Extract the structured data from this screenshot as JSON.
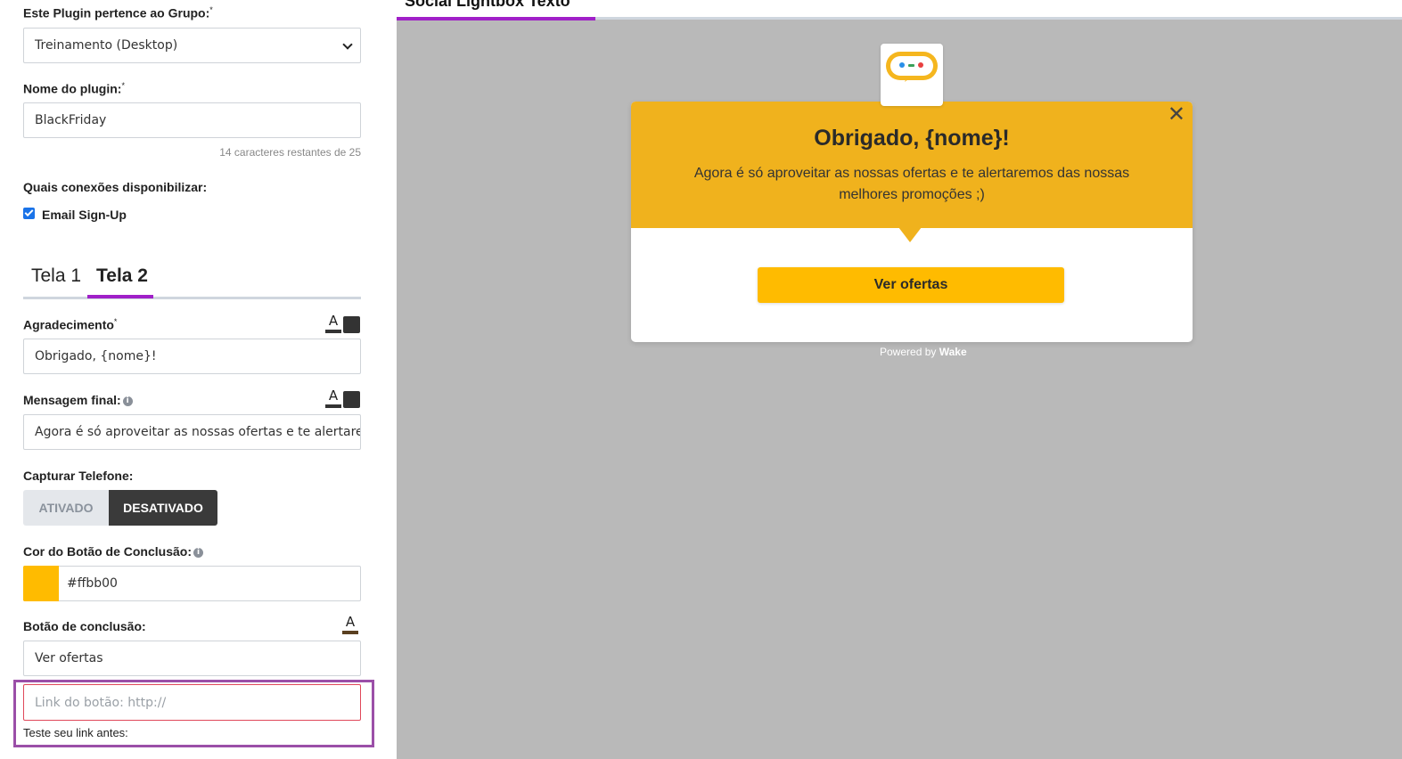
{
  "form": {
    "group_label": "Este Plugin pertence ao Grupo:",
    "group_value": "Treinamento (Desktop)",
    "name_label": "Nome do plugin:",
    "name_value": "BlackFriday",
    "name_counter": "14 caracteres restantes de 25",
    "connections_label": "Quais conexões disponibilizar:",
    "connection_email": "Email Sign-Up",
    "tabs": [
      {
        "label": "Tela 1",
        "active": false
      },
      {
        "label": "Tela 2",
        "active": true
      }
    ],
    "thanks_label": "Agradecimento",
    "thanks_value": "Obrigado, {nome}!",
    "final_msg_label": "Mensagem final:",
    "final_msg_value": "Agora é só aproveitar as nossas ofertas e te alertaremos das nossas melhores promoções ;)",
    "phone_label": "Capturar Telefone:",
    "phone_on": "ATIVADO",
    "phone_off": "DESATIVADO",
    "btn_color_label": "Cor do Botão de Conclusão:",
    "btn_color_value": "#ffbb00",
    "btn_label_label": "Botão de conclusão:",
    "btn_label_value": "Ver ofertas",
    "link_placeholder": "Link do botão: http://",
    "test_link": "Teste seu link antes:",
    "required_mark": "*",
    "format_letter": "A",
    "info_glyph": "i"
  },
  "preview": {
    "tab_title": "Social Lightbox Texto",
    "title": "Obrigado, {nome}!",
    "message": "Agora é só aproveitar as nossas ofertas e te alertaremos das nossas melhores promoções ;)",
    "button": "Ver ofertas",
    "close_glyph": "✕",
    "powered_prefix": "Powered by",
    "powered_brand": "Wake"
  },
  "colors": {
    "accent": "#a020c8",
    "button": "#ffbb00",
    "header": "#f0b21d",
    "highlight": "#9b4fa8"
  }
}
